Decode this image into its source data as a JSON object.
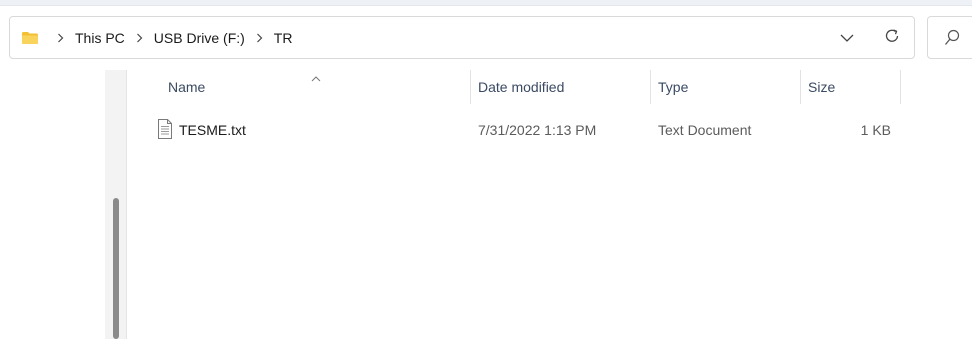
{
  "address": {
    "crumbs": [
      "This PC",
      "USB Drive (F:)",
      "TR"
    ],
    "folder_icon": "folder-icon",
    "dropdown_icon": "chevron-down-icon",
    "refresh_icon": "refresh-icon"
  },
  "search": {
    "icon": "search-icon"
  },
  "columns": {
    "name": "Name",
    "date": "Date modified",
    "type": "Type",
    "size": "Size",
    "sort_icon": "sort-up-icon"
  },
  "files": [
    {
      "name": "TESME.txt",
      "date": "7/31/2022 1:13 PM",
      "type": "Text Document",
      "size": "1 KB",
      "icon": "text-file-icon"
    }
  ],
  "colors": {
    "folder": "#f3c033",
    "header_text": "#3b4a63",
    "scroll_thumb": "#8a8a8a"
  }
}
